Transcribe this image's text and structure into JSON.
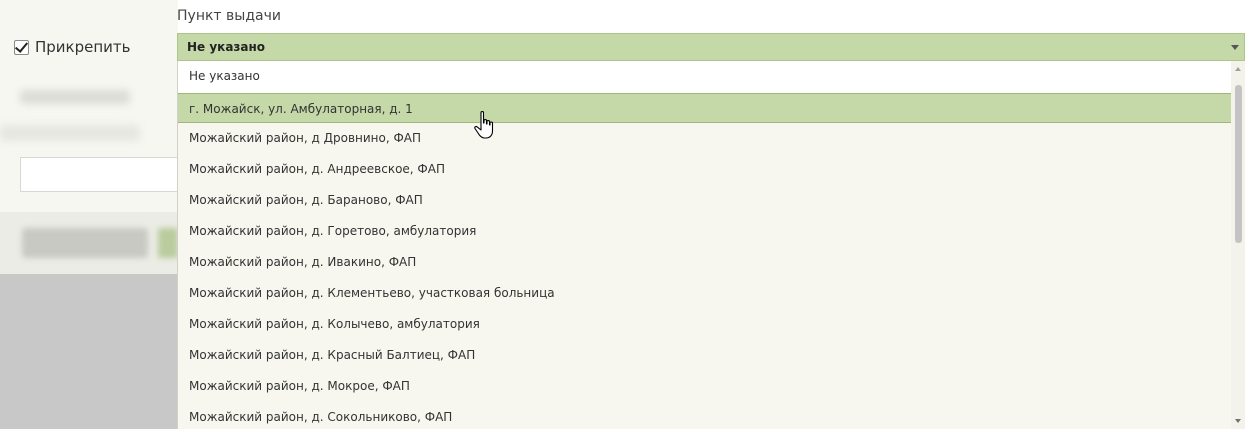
{
  "attach": {
    "label": "Прикрепить",
    "checked": true
  },
  "pickup": {
    "label": "Пункт выдачи",
    "selected": "Не указано"
  },
  "dropdown": {
    "hover_index": 1,
    "options": [
      "Не указано",
      "г. Можайск, ул. Амбулаторная, д. 1",
      "Можайский район, д Дровнино, ФАП",
      "Можайский район, д. Андреевское, ФАП",
      "Можайский район, д. Бараново, ФАП",
      "Можайский район, д. Горетово, амбулатория",
      "Можайский район, д. Ивакино, ФАП",
      "Можайский район, д. Клементьево, участковая больница",
      "Можайский район, д. Колычево, амбулатория",
      "Можайский район, д. Красный Балтиец, ФАП",
      "Можайский район, д. Мокрое, ФАП",
      "Можайский район, д. Сокольниково, ФАП"
    ]
  },
  "colors": {
    "accent": "#c5d9a8",
    "accent_border": "#9fb87a",
    "list_bg": "#f7f7f0"
  },
  "icons": {
    "checkbox": "checkmark-icon",
    "dropdown_arrow": "chevron-down-icon",
    "cursor": "hand-pointer-icon"
  }
}
